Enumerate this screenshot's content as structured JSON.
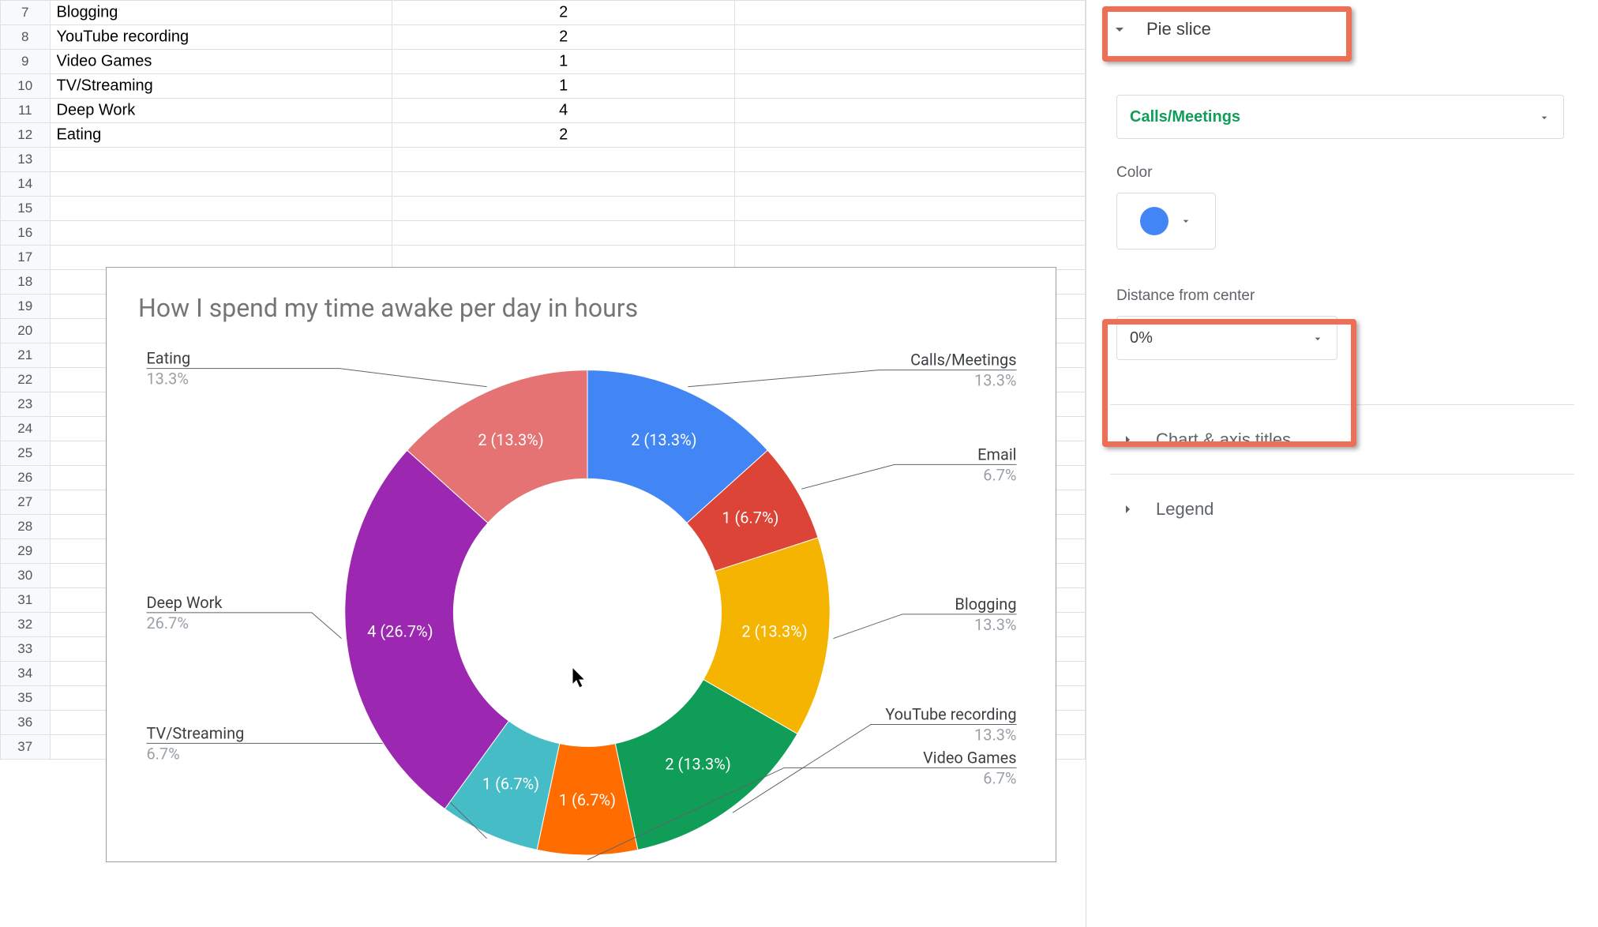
{
  "rows": [
    {
      "num": 7,
      "a": "Blogging",
      "b": "2"
    },
    {
      "num": 8,
      "a": "YouTube recording",
      "b": "2"
    },
    {
      "num": 9,
      "a": "Video Games",
      "b": "1"
    },
    {
      "num": 10,
      "a": "TV/Streaming",
      "b": "1"
    },
    {
      "num": 11,
      "a": "Deep Work",
      "b": "4"
    },
    {
      "num": 12,
      "a": "Eating",
      "b": "2"
    },
    {
      "num": 13,
      "a": "",
      "b": ""
    },
    {
      "num": 14,
      "a": "",
      "b": ""
    },
    {
      "num": 15,
      "a": "",
      "b": ""
    },
    {
      "num": 16,
      "a": "",
      "b": ""
    },
    {
      "num": 17,
      "a": "",
      "b": ""
    },
    {
      "num": 18,
      "a": "",
      "b": ""
    },
    {
      "num": 19,
      "a": "",
      "b": ""
    },
    {
      "num": 20,
      "a": "",
      "b": ""
    },
    {
      "num": 21,
      "a": "",
      "b": ""
    },
    {
      "num": 22,
      "a": "",
      "b": ""
    },
    {
      "num": 23,
      "a": "",
      "b": ""
    },
    {
      "num": 24,
      "a": "",
      "b": ""
    },
    {
      "num": 25,
      "a": "",
      "b": ""
    },
    {
      "num": 26,
      "a": "",
      "b": ""
    },
    {
      "num": 27,
      "a": "",
      "b": ""
    },
    {
      "num": 28,
      "a": "",
      "b": ""
    },
    {
      "num": 29,
      "a": "",
      "b": ""
    },
    {
      "num": 30,
      "a": "",
      "b": ""
    },
    {
      "num": 31,
      "a": "",
      "b": ""
    },
    {
      "num": 32,
      "a": "",
      "b": ""
    },
    {
      "num": 33,
      "a": "",
      "b": ""
    },
    {
      "num": 34,
      "a": "",
      "b": ""
    },
    {
      "num": 35,
      "a": "",
      "b": ""
    },
    {
      "num": 36,
      "a": "",
      "b": ""
    },
    {
      "num": 37,
      "a": "",
      "b": ""
    }
  ],
  "sidebar": {
    "pie_slice_label": "Pie slice",
    "selected_slice": "Calls/Meetings",
    "color_label": "Color",
    "swatch_color": "#4285F4",
    "distance_label": "Distance from center",
    "distance_value": "0%",
    "chart_axis_titles_label": "Chart & axis titles",
    "legend_label": "Legend"
  },
  "chart_data": {
    "type": "pie",
    "title": "How I spend my time awake per day in hours",
    "donut_hole": 0.55,
    "series": [
      {
        "name": "Calls/Meetings",
        "value": 2,
        "percent": 13.3,
        "color": "#4285F4"
      },
      {
        "name": "Email",
        "value": 1,
        "percent": 6.7,
        "color": "#DB4437"
      },
      {
        "name": "Blogging",
        "value": 2,
        "percent": 13.3,
        "color": "#F4B400"
      },
      {
        "name": "YouTube recording",
        "value": 2,
        "percent": 13.3,
        "color": "#0F9D58"
      },
      {
        "name": "Video Games",
        "value": 1,
        "percent": 6.7,
        "color": "#FF6D00"
      },
      {
        "name": "TV/Streaming",
        "value": 1,
        "percent": 6.7,
        "color": "#46BDC6"
      },
      {
        "name": "Deep Work",
        "value": 4,
        "percent": 26.7,
        "color": "#9C27B0"
      },
      {
        "name": "Eating",
        "value": 2,
        "percent": 13.3,
        "color": "#E57373"
      }
    ],
    "label_format": "{value} ({percent}%)"
  }
}
